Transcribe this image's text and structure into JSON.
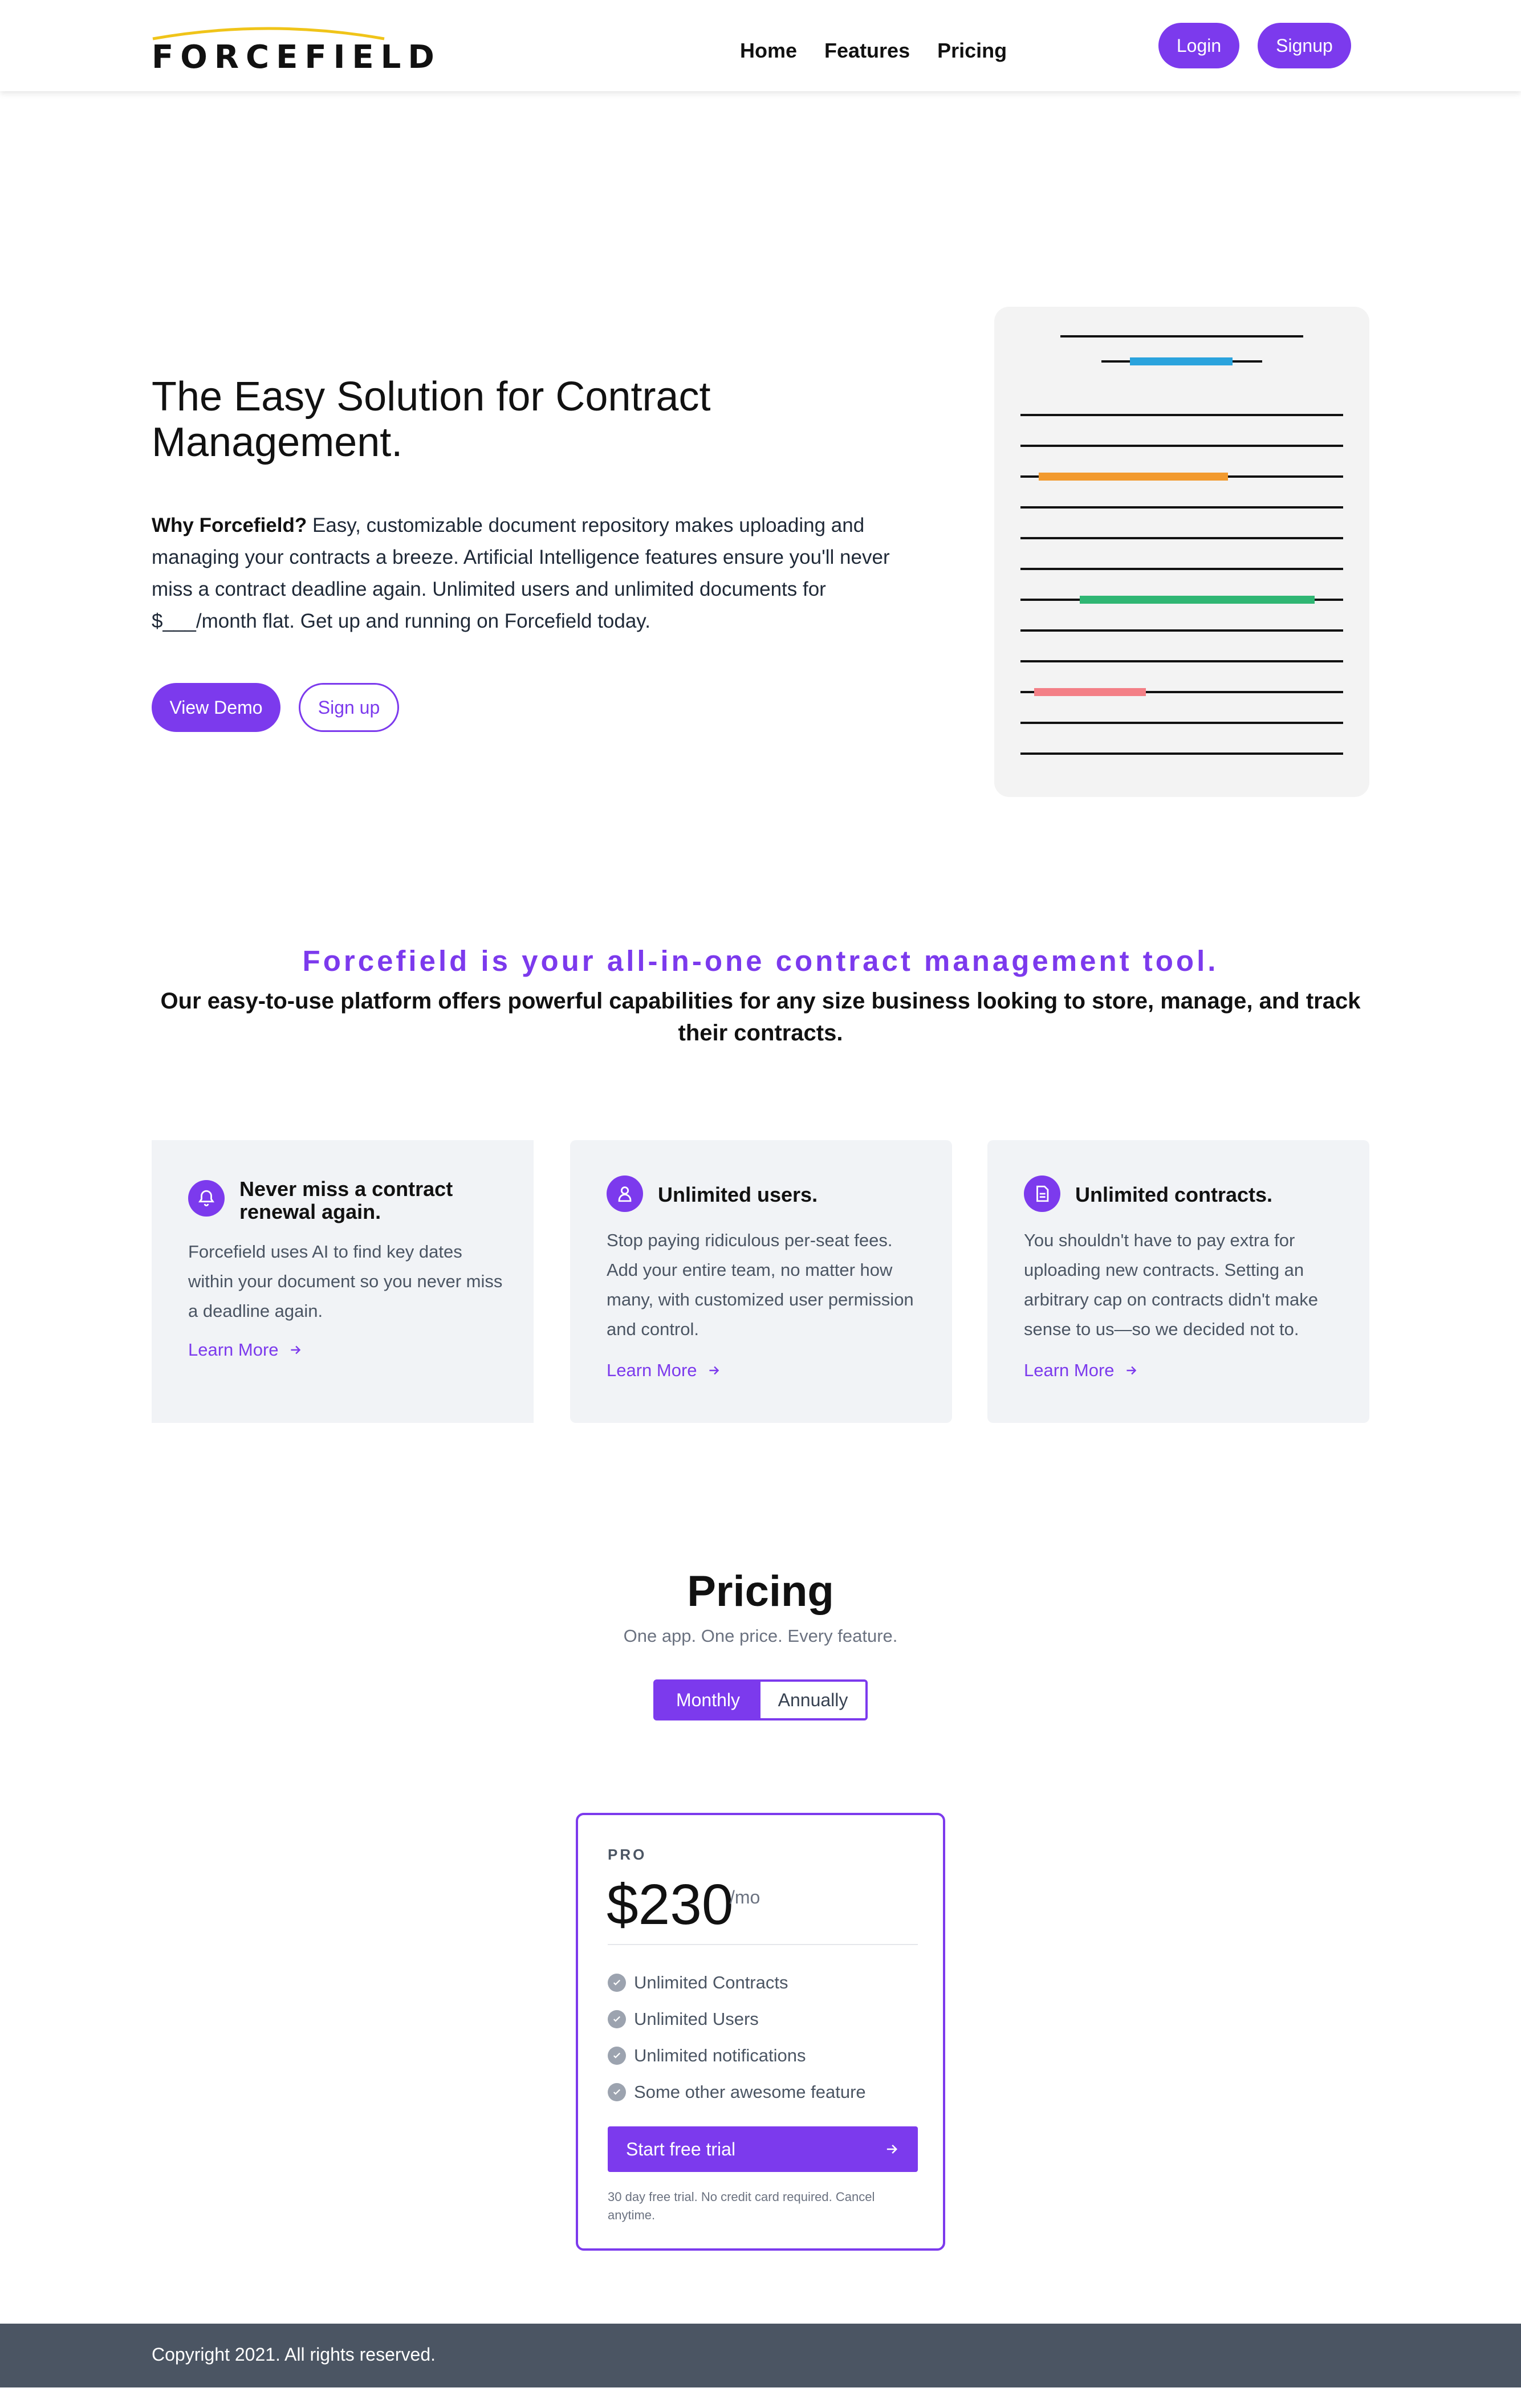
{
  "nav": {
    "logo_text": "FORCEFIELD",
    "links": [
      "Home",
      "Features",
      "Pricing"
    ],
    "login_label": "Login",
    "signup_label": "Signup"
  },
  "hero": {
    "title": "The Easy Solution for Contract Management.",
    "body_bold": "Why Forcefield?",
    "body_text": " Easy, customizable document repository makes uploading and managing your contracts a breeze. Artificial Intelligence features ensure you'll never miss a contract deadline again. Unlimited users and unlimited documents for $___/month flat. Get up and running on Forcefield today.",
    "demo_label": "View Demo",
    "signup_label": "Sign up"
  },
  "illustration": {
    "accent_colors": [
      "#2aa3dd",
      "#f29a2e",
      "#2fb673",
      "#f37f86"
    ]
  },
  "tagline": {
    "heading": "Forcefield is your all-in-one contract management tool.",
    "sub": "Our easy-to-use platform offers powerful capabilities for any size business looking to store, manage, and track their contracts."
  },
  "features": [
    {
      "icon": "bell-icon",
      "title": "Never miss a contract renewal again.",
      "text": "Forcefield uses AI to find key dates within your document so you never miss a deadline again.",
      "link": "Learn More"
    },
    {
      "icon": "user-icon",
      "title": "Unlimited users.",
      "text": "Stop paying ridiculous per-seat fees. Add your entire team, no matter how many, with customized user permission and control.",
      "link": "Learn More"
    },
    {
      "icon": "document-icon",
      "title": "Unlimited contracts.",
      "text": "You shouldn't have to pay extra for uploading new contracts. Setting an arbitrary cap on contracts didn't make sense to us—so we decided not to.",
      "link": "Learn More"
    }
  ],
  "pricing": {
    "title": "Pricing",
    "subtitle": "One app. One price. Every feature.",
    "toggle": {
      "monthly": "Monthly",
      "annually": "Annually",
      "selected": "Monthly"
    },
    "plan": {
      "name": "PRO",
      "price": "$230",
      "unit": "/mo",
      "features": [
        "Unlimited Contracts",
        "Unlimited Users",
        "Unlimited notifications",
        "Some other awesome feature"
      ],
      "cta": "Start free trial",
      "note": "30 day free trial. No credit card required. Cancel anytime."
    }
  },
  "footer": {
    "copyright": "Copyright 2021. All rights reserved."
  },
  "colors": {
    "brand": "#7c3aed",
    "footer_bg": "#4b5563",
    "card_bg": "#f1f3f6",
    "logo_arc": "#f0c419"
  }
}
